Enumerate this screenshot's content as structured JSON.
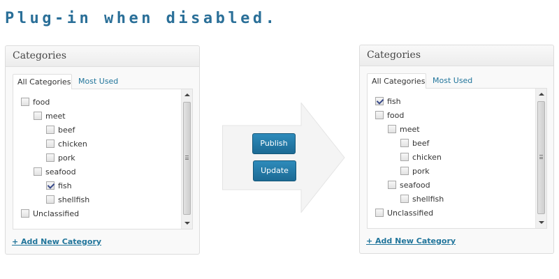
{
  "heading": "Plug-in when disabled.",
  "colors": {
    "heading": "#2a6f98",
    "link": "#21759b",
    "button": "#2277a6"
  },
  "left_panel": {
    "title": "Categories",
    "tabs": {
      "all": "All Categories",
      "most_used": "Most Used"
    },
    "items": [
      {
        "label": "food",
        "checked": false,
        "level": 0
      },
      {
        "label": "meet",
        "checked": false,
        "level": 1
      },
      {
        "label": "beef",
        "checked": false,
        "level": 2
      },
      {
        "label": "chicken",
        "checked": false,
        "level": 2
      },
      {
        "label": "pork",
        "checked": false,
        "level": 2
      },
      {
        "label": "seafood",
        "checked": false,
        "level": 1
      },
      {
        "label": "fish",
        "checked": true,
        "level": 2
      },
      {
        "label": "shellfish",
        "checked": false,
        "level": 2
      },
      {
        "label": "Unclassified",
        "checked": false,
        "level": 0
      }
    ],
    "add_link": "+ Add New Category"
  },
  "actions": {
    "publish": "Publish",
    "update": "Update"
  },
  "right_panel": {
    "title": "Categories",
    "tabs": {
      "all": "All Categories",
      "most_used": "Most Used"
    },
    "items": [
      {
        "label": "fish",
        "checked": true,
        "level": 0
      },
      {
        "label": "food",
        "checked": false,
        "level": 0
      },
      {
        "label": "meet",
        "checked": false,
        "level": 1
      },
      {
        "label": "beef",
        "checked": false,
        "level": 2
      },
      {
        "label": "chicken",
        "checked": false,
        "level": 2
      },
      {
        "label": "pork",
        "checked": false,
        "level": 2
      },
      {
        "label": "seafood",
        "checked": false,
        "level": 1
      },
      {
        "label": "shellfish",
        "checked": false,
        "level": 2
      },
      {
        "label": "Unclassified",
        "checked": false,
        "level": 0
      }
    ],
    "add_link": "+ Add New Category"
  }
}
